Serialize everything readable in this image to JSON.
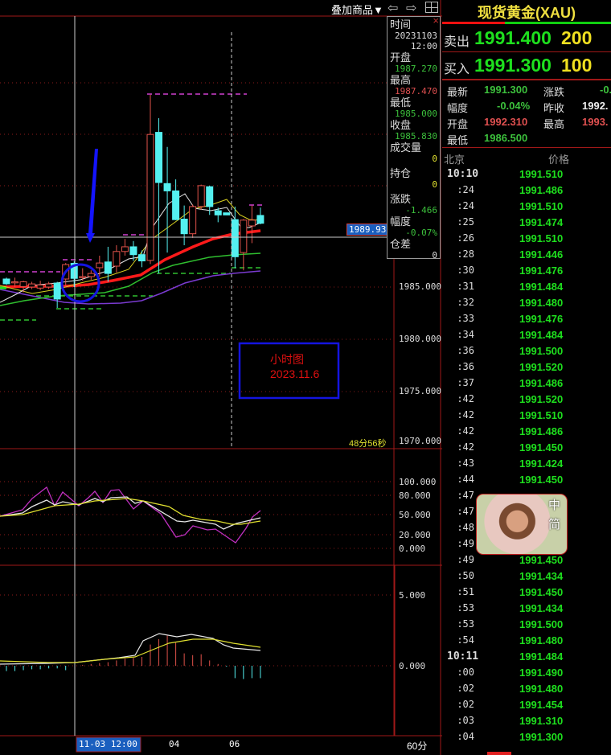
{
  "toolbar": {
    "overlay_label": "叠加商品▼",
    "back_icon": "arrow-left",
    "forward_icon": "arrow-right",
    "layout_icon": "grid"
  },
  "chart": {
    "price_axis": [
      "1985.000",
      "1980.000",
      "1975.000",
      "1970.000"
    ],
    "current_price_tag": "1989.93",
    "countdown": "48分56秒",
    "kdj_axis": [
      "100.000",
      "80.000",
      "50.000",
      "20.000",
      "0.000"
    ],
    "macd_axis": [
      "5.000",
      "0.000"
    ],
    "time_axis": {
      "cursor": "11-03 12:00",
      "ticks": [
        "04",
        "06"
      ],
      "period": "60分"
    },
    "annotation": {
      "line1": "小时图",
      "line2": "2023.11.6"
    }
  },
  "chart_data": {
    "type": "candlestick",
    "candles": [
      [
        1985.77,
        1985.9,
        1985.2,
        1985.31
      ],
      [
        1985.4,
        1985.9,
        1985.0,
        1985.5
      ],
      [
        1985.05,
        1985.6,
        1984.5,
        1985.5
      ],
      [
        1985.0,
        1985.5,
        1984.8,
        1985.3
      ],
      [
        1984.9,
        1985.6,
        1984.7,
        1985.2
      ],
      [
        1985.0,
        1985.5,
        1984.8,
        1985.3
      ],
      [
        1985.38,
        1985.5,
        1983.0,
        1983.85
      ],
      [
        1985.77,
        1987.3,
        1985.0,
        1987.15
      ],
      [
        1987.27,
        1987.47,
        1985.0,
        1985.83
      ],
      [
        1985.9,
        1986.8,
        1985.6,
        1986.0
      ],
      [
        1986.0,
        1986.6,
        1985.7,
        1986.3
      ],
      [
        1986.85,
        1988.0,
        1986.0,
        1987.3
      ],
      [
        1987.4,
        1988.85,
        1985.5,
        1986.3
      ],
      [
        1987.0,
        1989.0,
        1986.4,
        1988.4
      ],
      [
        1988.4,
        1989.6,
        1988.0,
        1988.85
      ],
      [
        1988.85,
        1989.4,
        1987.5,
        1988.1
      ],
      [
        1988.1,
        1988.5,
        1986.9,
        1987.5
      ],
      [
        1987.55,
        2003.4,
        1987.2,
        1999.6
      ],
      [
        1999.8,
        2001.15,
        1986.3,
        1995.0
      ],
      [
        1994.9,
        1998.4,
        1988.3,
        1994.2
      ],
      [
        1994.2,
        1995.3,
        1991.4,
        1991.45
      ],
      [
        1991.5,
        1992.8,
        1989.0,
        1990.1
      ],
      [
        1990.1,
        1992.9,
        1989.7,
        1992.7
      ],
      [
        1992.7,
        1994.8,
        1992.4,
        1994.7
      ],
      [
        1994.6,
        1994.7,
        1991.9,
        1992.7
      ],
      [
        1992.3,
        1992.6,
        1991.2,
        1991.9
      ],
      [
        1992.1,
        1992.1,
        1991.9,
        1991.9
      ],
      [
        1991.45,
        1992.7,
        1986.8,
        1987.9
      ],
      [
        1988.3,
        1991.5,
        1986.6,
        1991.4
      ],
      [
        1990.85,
        1992.8,
        1989.2,
        1991.4
      ],
      [
        1991.85,
        1992.6,
        1991.0,
        1991.1
      ]
    ],
    "ylim": [
      1969,
      2005
    ],
    "colors": {
      "up": "#e0524a",
      "down": "#54f0f0"
    }
  },
  "tooltip": {
    "time_label": "时间",
    "date": "20231103",
    "time": "12:00",
    "open_label": "开盘",
    "open": "1987.270",
    "high_label": "最高",
    "high": "1987.470",
    "low_label": "最低",
    "low": "1985.000",
    "close_label": "收盘",
    "close": "1985.830",
    "volume_label": "成交量",
    "volume": "0",
    "oi_label": "持仓",
    "oi": "0",
    "change_label": "涨跌",
    "change": "-1.466",
    "pct_label": "幅度",
    "pct": "-0.07%",
    "oi_diff_label": "仓差",
    "oi_diff": "0"
  },
  "quote": {
    "title": "现货黄金(XAU)",
    "sell_label": "卖出",
    "sell_price": "1991.400",
    "sell_qty": "200",
    "buy_label": "买入",
    "buy_price": "1991.300",
    "buy_qty": "100",
    "stats": {
      "last_label": "最新",
      "last": "1991.300",
      "chg_label": "涨跌",
      "chg": "-0.",
      "pct_label": "幅度",
      "pct": "-0.04%",
      "prev_label": "昨收",
      "prev": "1992.",
      "open_label": "开盘",
      "open": "1992.310",
      "high_label": "最高",
      "high": "1993.",
      "low_label": "最低",
      "low": "1986.500"
    },
    "ticks_header": {
      "time": "北京",
      "price": "价格"
    },
    "ticks": [
      {
        "t": "10:10",
        "p": "1991.510",
        "b": true
      },
      {
        "t": ":24",
        "p": "1991.486"
      },
      {
        "t": ":24",
        "p": "1991.510"
      },
      {
        "t": ":25",
        "p": "1991.474"
      },
      {
        "t": ":26",
        "p": "1991.510"
      },
      {
        "t": ":28",
        "p": "1991.446"
      },
      {
        "t": ":30",
        "p": "1991.476"
      },
      {
        "t": ":31",
        "p": "1991.484"
      },
      {
        "t": ":32",
        "p": "1991.480"
      },
      {
        "t": ":33",
        "p": "1991.476"
      },
      {
        "t": ":34",
        "p": "1991.484"
      },
      {
        "t": ":36",
        "p": "1991.500"
      },
      {
        "t": ":36",
        "p": "1991.520"
      },
      {
        "t": ":37",
        "p": "1991.486"
      },
      {
        "t": ":42",
        "p": "1991.520"
      },
      {
        "t": ":42",
        "p": "1991.510"
      },
      {
        "t": ":42",
        "p": "1991.486"
      },
      {
        "t": ":42",
        "p": "1991.450"
      },
      {
        "t": ":43",
        "p": "1991.424"
      },
      {
        "t": ":44",
        "p": "1991.450"
      },
      {
        "t": ":47",
        "p": ""
      },
      {
        "t": ":47",
        "p": ""
      },
      {
        "t": ":48",
        "p": ""
      },
      {
        "t": ":49",
        "p": ""
      },
      {
        "t": ":49",
        "p": "1991.450"
      },
      {
        "t": ":50",
        "p": "1991.434"
      },
      {
        "t": ":51",
        "p": "1991.450"
      },
      {
        "t": ":53",
        "p": "1991.434"
      },
      {
        "t": ":53",
        "p": "1991.500"
      },
      {
        "t": ":54",
        "p": "1991.480"
      },
      {
        "t": "10:11",
        "p": "1991.484",
        "b": true
      },
      {
        "t": ":00",
        "p": "1991.490"
      },
      {
        "t": ":02",
        "p": "1991.480"
      },
      {
        "t": ":02",
        "p": "1991.454"
      },
      {
        "t": ":03",
        "p": "1991.310"
      },
      {
        "t": ":04",
        "p": "1991.300"
      }
    ],
    "ad_overlay": {
      "line1": "中",
      "line2": "简"
    }
  }
}
